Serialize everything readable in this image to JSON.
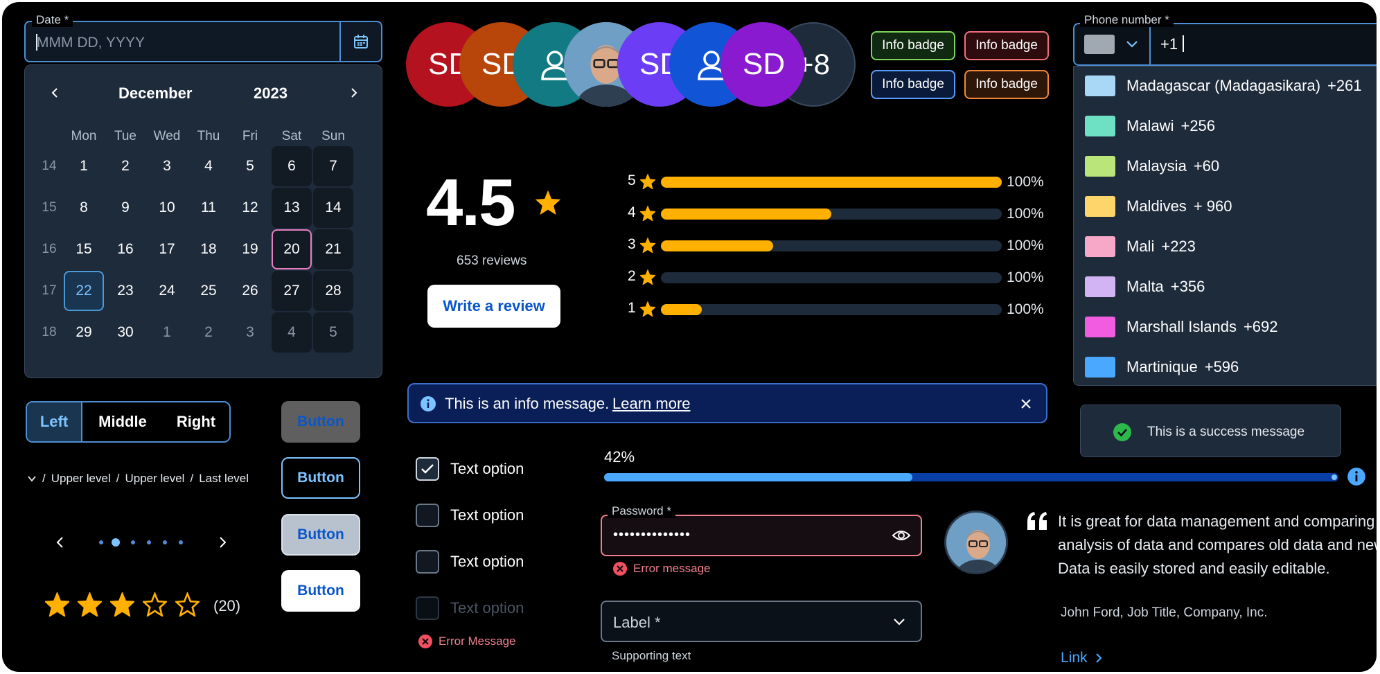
{
  "colors": {
    "background": "#000000",
    "surface": "#1e2b3b",
    "accent": "#4d8fd6",
    "star": "#ffb000",
    "error": "#f08090",
    "success": "#2db84d",
    "link": "#4aa8ff"
  },
  "date_picker": {
    "label": "Date *",
    "placeholder": "MMM DD, YYYY",
    "icon": "calendar-icon",
    "month": "December",
    "year": "2023",
    "weekdays": [
      "Mon",
      "Tue",
      "Wed",
      "Thu",
      "Fri",
      "Sat",
      "Sun"
    ],
    "weeks": [
      {
        "week": "14",
        "days": [
          "1",
          "2",
          "3",
          "4",
          "5",
          "6",
          "7"
        ]
      },
      {
        "week": "15",
        "days": [
          "8",
          "9",
          "10",
          "11",
          "12",
          "13",
          "14"
        ]
      },
      {
        "week": "16",
        "days": [
          "15",
          "16",
          "17",
          "18",
          "19",
          "20",
          "21"
        ]
      },
      {
        "week": "17",
        "days": [
          "22",
          "23",
          "24",
          "25",
          "26",
          "27",
          "28"
        ]
      },
      {
        "week": "18",
        "days": [
          "29",
          "30",
          "1",
          "2",
          "3",
          "4",
          "5"
        ]
      }
    ],
    "today": "22",
    "selected": "20"
  },
  "segmented": {
    "items": [
      "Left",
      "Middle",
      "Right"
    ],
    "active": "Left"
  },
  "breadcrumb": {
    "items": [
      "Upper level",
      "Upper level",
      "Last level"
    ]
  },
  "pager": {
    "count": 6,
    "active": 1
  },
  "star_input": {
    "value": 3,
    "max": 5,
    "count": "(20)"
  },
  "buttons": {
    "labels": [
      "Button",
      "Button",
      "Button",
      "Button"
    ]
  },
  "avatars": {
    "items": [
      {
        "kind": "initials",
        "text": "SD",
        "color": "#b3121e"
      },
      {
        "kind": "initials",
        "text": "SD",
        "color": "#b8450a"
      },
      {
        "kind": "icon",
        "icon": "person-icon",
        "color": "#127a83"
      },
      {
        "kind": "photo"
      },
      {
        "kind": "initials",
        "text": "SD",
        "color": "#6b3ef5"
      },
      {
        "kind": "icon",
        "icon": "person-icon",
        "color": "#1155d6"
      },
      {
        "kind": "initials",
        "text": "SD",
        "color": "#8a1ad0"
      }
    ],
    "overflow": "+8"
  },
  "badges": [
    {
      "label": "Info badge",
      "color": "#7ed65a",
      "bg": "#0f2a10"
    },
    {
      "label": "Info badge",
      "color": "#f0707a",
      "bg": "#2e0c0e"
    },
    {
      "label": "Info badge",
      "color": "#5a9cff",
      "bg": "#0a1a3a"
    },
    {
      "label": "Info badge",
      "color": "#f08a3a",
      "bg": "#2e1608"
    }
  ],
  "rating": {
    "average": "4.5",
    "reviews": "653 reviews",
    "cta": "Write a review",
    "bars": [
      {
        "stars": "5",
        "fill": 1.0,
        "pct": "100%"
      },
      {
        "stars": "4",
        "fill": 0.5,
        "pct": "100%"
      },
      {
        "stars": "3",
        "fill": 0.33,
        "pct": "100%"
      },
      {
        "stars": "2",
        "fill": 0.0,
        "pct": "100%"
      },
      {
        "stars": "1",
        "fill": 0.12,
        "pct": "100%"
      }
    ]
  },
  "info_message": {
    "text": "This is an info message.",
    "link": "Learn more"
  },
  "checkboxes": {
    "items": [
      {
        "label": "Text option",
        "state": "checked"
      },
      {
        "label": "Text option",
        "state": "unchecked"
      },
      {
        "label": "Text option",
        "state": "unchecked"
      },
      {
        "label": "Text option",
        "state": "disabled"
      }
    ],
    "error": "Error Message"
  },
  "progress": {
    "label": "42%",
    "value": 0.42
  },
  "password": {
    "label": "Password *",
    "value": "••••••••••••••",
    "error": "Error message"
  },
  "select": {
    "placeholder": "Label *",
    "supporting": "Supporting text"
  },
  "phone": {
    "label": "Phone number *",
    "value": "+1",
    "countries": [
      {
        "name": "Madagascar (Madagasikara)",
        "code": "+261",
        "color": "#a9d8f7"
      },
      {
        "name": "Malawi",
        "code": "+256",
        "color": "#6ee0c4"
      },
      {
        "name": "Malaysia",
        "code": "+60",
        "color": "#b9e57a"
      },
      {
        "name": "Maldives",
        "code": "+ 960",
        "color": "#fcd66a"
      },
      {
        "name": "Mali",
        "code": "+223",
        "color": "#f7a8c8"
      },
      {
        "name": "Malta",
        "code": "+356",
        "color": "#d2b4f5"
      },
      {
        "name": "Marshall Islands",
        "code": "+692",
        "color": "#f25ce0"
      },
      {
        "name": "Martinique",
        "code": "+596",
        "color": "#4aa8ff"
      }
    ]
  },
  "success_message": {
    "text": "This is a success message"
  },
  "testimonial": {
    "lines": [
      "It is great for data management and comparing",
      "analysis of data and compares old data and new.",
      "Data is easily stored and easily editable."
    ],
    "author": "John Ford, Job Title, Company, Inc.",
    "link": "Link"
  }
}
